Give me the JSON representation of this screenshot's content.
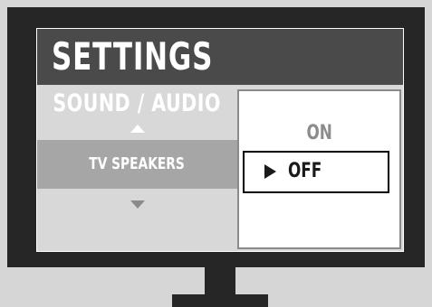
{
  "screen": {
    "title": "SETTINGS"
  },
  "menu": {
    "category": "SOUND / AUDIO",
    "selected_item": "TV SPEAKERS"
  },
  "options": {
    "on_label": "ON",
    "off_label": "OFF",
    "selected": "OFF"
  },
  "colors": {
    "bezel": "#262626",
    "title_bar": "#4a4a4a",
    "panel_bg": "#d8d8d8",
    "selected_row": "#a6a6a6",
    "options_bg": "#ffffff"
  },
  "icons": {
    "up": "triangle-up-icon",
    "down": "triangle-down-icon",
    "pointer": "play-pointer-icon"
  }
}
